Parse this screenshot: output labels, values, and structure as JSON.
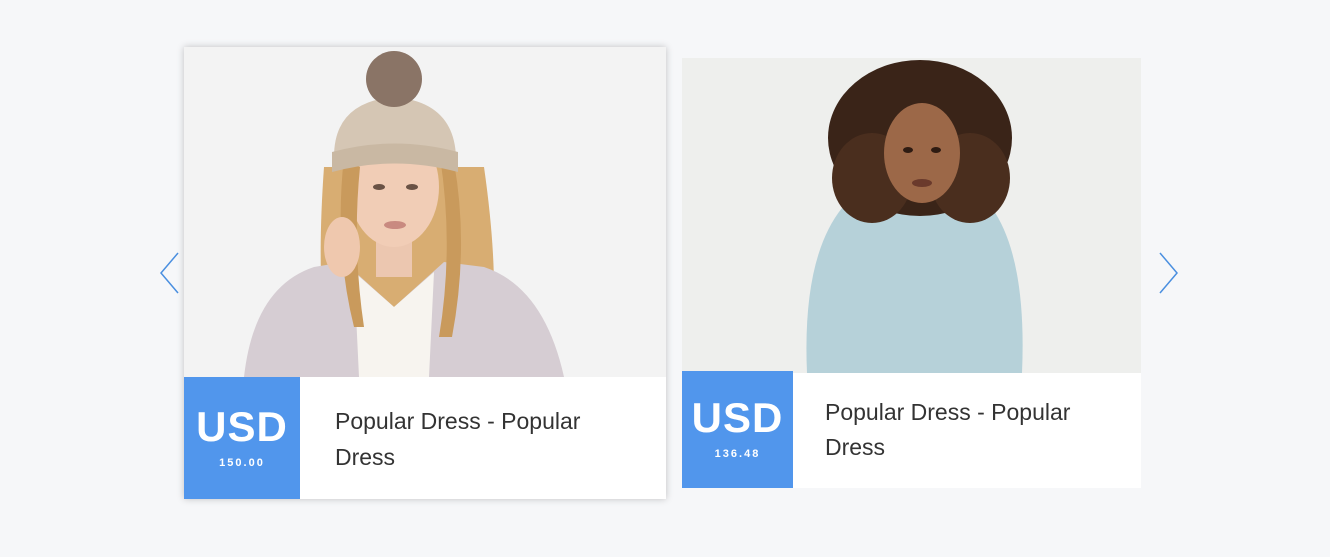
{
  "carousel": {
    "prev_icon": "chevron-left-icon",
    "next_icon": "chevron-right-icon",
    "accent_color": "#5196ec",
    "products": [
      {
        "currency": "USD",
        "price": "150.00",
        "name": "Popular Dress - Popular Dress",
        "image": "woman in knit beanie and lilac jacket"
      },
      {
        "currency": "USD",
        "price": "136.48",
        "name": "Popular Dress - Popular Dress",
        "image": "woman with curly hair in light blue sweatshirt"
      }
    ]
  }
}
